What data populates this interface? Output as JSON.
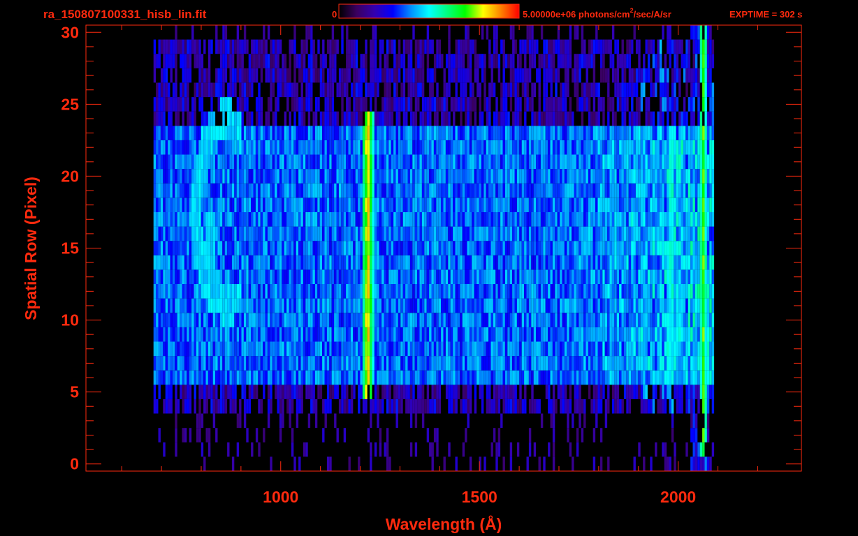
{
  "header": {
    "filename": "ra_150807100331_hisb_lin.fit",
    "colorbar_min_label": "0",
    "colorbar_max_label": "5.00000e+06 photons/cm",
    "colorbar_max_label_sup": "2",
    "colorbar_max_label_tail": "/sec/A/sr",
    "exptime_label": "EXPTIME = 302 s"
  },
  "colors": {
    "background": "#000000",
    "axis": "#ff2a0e",
    "colormap": [
      "#000000",
      "#3a0060",
      "#3300b0",
      "#0000ff",
      "#0090ff",
      "#00ffff",
      "#00ff80",
      "#00ff00",
      "#ffff00",
      "#ff8000",
      "#ff0000"
    ]
  },
  "chart_data": {
    "type": "heatmap",
    "title": "ra_150807100331_hisb_lin.fit",
    "xlabel": "Wavelength (Å)",
    "ylabel": "Spatial Row (Pixel)",
    "xlim": [
      510,
      2310
    ],
    "ylim": [
      -0.5,
      30.5
    ],
    "xticks": [
      1000,
      1500,
      2000
    ],
    "yticks": [
      0,
      5,
      10,
      15,
      20,
      25,
      30
    ],
    "x_minor_ticks": [
      600,
      700,
      800,
      900,
      1100,
      1200,
      1300,
      1400,
      1600,
      1700,
      1800,
      1900,
      2100,
      2200
    ],
    "y_minor_ticks": [
      1,
      2,
      3,
      4,
      6,
      7,
      8,
      9,
      11,
      12,
      13,
      14,
      16,
      17,
      18,
      19,
      21,
      22,
      23,
      24,
      26,
      27,
      28,
      29
    ],
    "colorbar": {
      "min": 0,
      "max": 5000000,
      "units": "photons/cm^2/sec/A/sr",
      "colormap": "rainbow"
    },
    "exptime_s": 302,
    "data_extent": {
      "x_range": [
        680,
        2090
      ],
      "row_range": [
        0,
        30
      ],
      "bright_band_rows": [
        6,
        23
      ]
    },
    "features": [
      {
        "wavelength": 1216,
        "rows": [
          5,
          24
        ],
        "intensity": 0.92
      },
      {
        "wavelength": 1025,
        "rows": [
          7,
          23
        ],
        "intensity": 0.42
      },
      {
        "wavelength": 1310,
        "rows": [
          6,
          23
        ],
        "intensity": 0.4
      },
      {
        "wavelength": 1360,
        "rows": [
          6,
          23
        ],
        "intensity": 0.4
      },
      {
        "wavelength": 1500,
        "rows": [
          6,
          23
        ],
        "intensity": 0.38
      },
      {
        "wavelength": 1830,
        "rows": [
          6,
          23
        ],
        "intensity": 0.5
      },
      {
        "wavelength": 1980,
        "rows": [
          6,
          23
        ],
        "intensity": 0.62
      },
      {
        "wavelength": 2060,
        "rows": [
          1,
          30
        ],
        "intensity": 0.78
      }
    ]
  }
}
